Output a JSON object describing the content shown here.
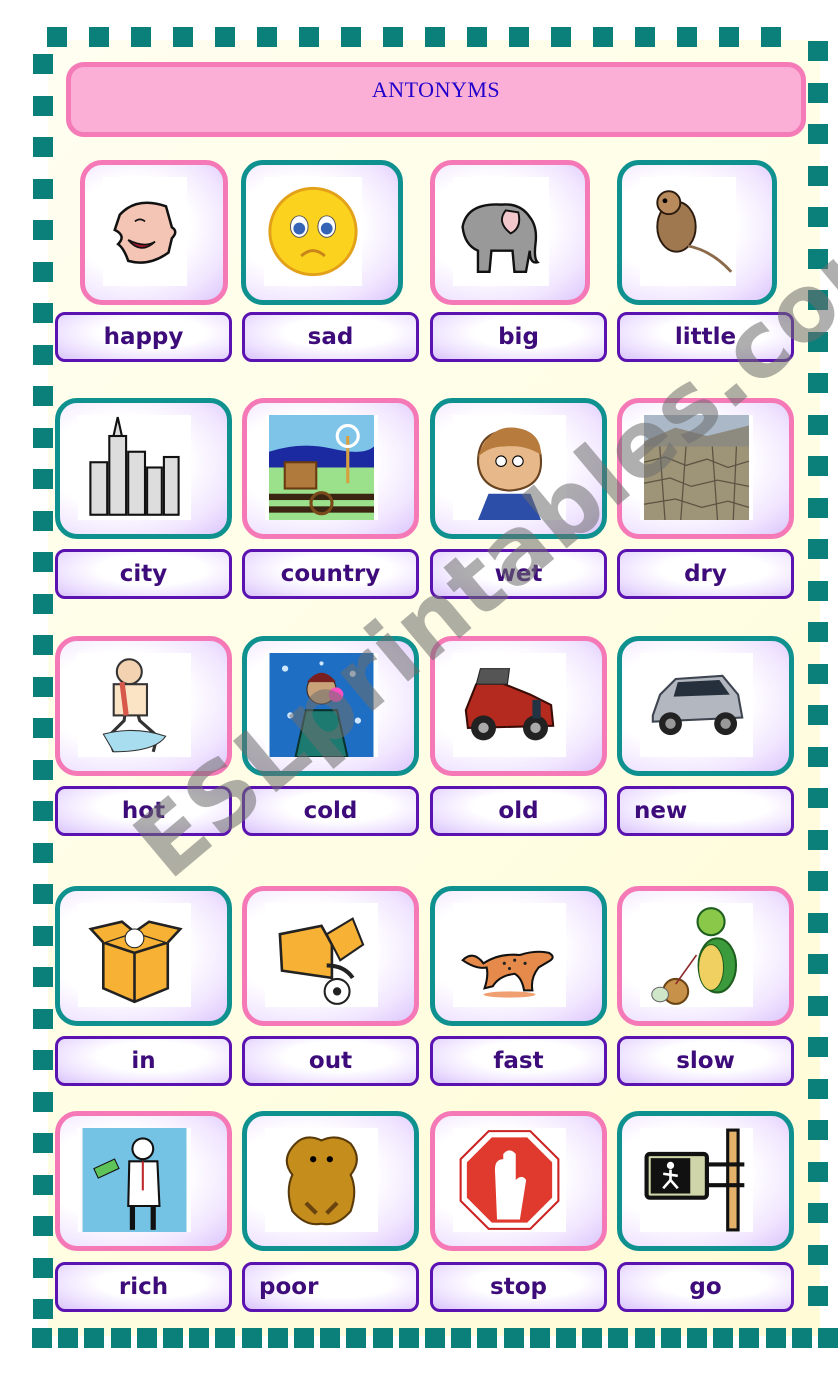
{
  "title": "ANTONYMS",
  "watermark": "ESLprintables.com",
  "colors": {
    "border_squares": "#0b7f7a",
    "title_fill": "#fbafd6",
    "title_border": "#f47ab8",
    "title_text": "#2200cc",
    "card_pink": "#f479b6",
    "card_teal": "#0f9190",
    "label_border": "#5a12b0",
    "label_text": "#3d0c7a"
  },
  "rows": [
    {
      "cards": [
        {
          "word": "happy",
          "picture": "laughing-face-icon",
          "frame": "pink"
        },
        {
          "word": "sad",
          "picture": "sad-smiley-icon",
          "frame": "teal"
        },
        {
          "word": "big",
          "picture": "elephant-icon",
          "frame": "pink"
        },
        {
          "word": "little",
          "picture": "mouse-icon",
          "frame": "teal"
        }
      ]
    },
    {
      "cards": [
        {
          "word": "city",
          "picture": "skyscrapers-icon",
          "frame": "teal"
        },
        {
          "word": "country",
          "picture": "farm-windmill-icon",
          "frame": "pink"
        },
        {
          "word": "wet",
          "picture": "wet-boy-icon",
          "frame": "teal"
        },
        {
          "word": "dry",
          "picture": "cracked-earth-icon",
          "frame": "pink"
        }
      ]
    },
    {
      "cards": [
        {
          "word": "hot",
          "picture": "sweating-man-icon",
          "frame": "pink"
        },
        {
          "word": "cold",
          "picture": "freezing-man-icon",
          "frame": "teal"
        },
        {
          "word": "old",
          "picture": "vintage-car-icon",
          "frame": "pink"
        },
        {
          "word": "new",
          "picture": "modern-suv-icon",
          "frame": "teal"
        }
      ]
    },
    {
      "cards": [
        {
          "word": "in",
          "picture": "ball-in-box-icon",
          "frame": "teal"
        },
        {
          "word": "out",
          "picture": "ball-out-of-box-icon",
          "frame": "pink"
        },
        {
          "word": "fast",
          "picture": "cheetah-icon",
          "frame": "teal"
        },
        {
          "word": "slow",
          "picture": "turtle-snail-icon",
          "frame": "pink"
        }
      ]
    },
    {
      "cards": [
        {
          "word": "rich",
          "picture": "rich-man-icon",
          "frame": "pink"
        },
        {
          "word": "poor",
          "picture": "poor-bear-icon",
          "frame": "teal"
        },
        {
          "word": "stop",
          "picture": "stop-sign-icon",
          "frame": "pink"
        },
        {
          "word": "go",
          "picture": "walk-signal-icon",
          "frame": "teal"
        }
      ]
    }
  ]
}
